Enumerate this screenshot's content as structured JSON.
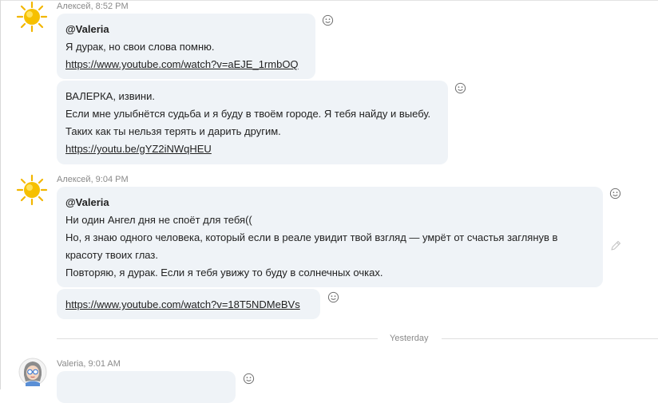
{
  "messages": [
    {
      "meta": "Алексей, 8:52 PM",
      "bubbles": [
        {
          "lines": [
            "@Valeria",
            "Я дурак, но свои слова помню.",
            "https://www.youtube.com/watch?v=aEJE_1rmbOQ"
          ]
        },
        {
          "lines": [
            "ВАЛЕРКА, извини.",
            "Если мне улыбнётся судьба и я буду в твоём городе. Я тебя найду и выебу.",
            "Таких как ты нельзя терять и дарить другим.",
            "https://youtu.be/gYZ2iNWqHEU"
          ]
        }
      ]
    },
    {
      "meta": "Алексей, 9:04 PM",
      "bubbles": [
        {
          "lines": [
            "@Valeria",
            "Ни один Ангел дня не споёт для тебя((",
            "Но, я знаю одного человека, который если в реале увидит твой взгляд — умрёт от счастья заглянув в",
            "красоту твоих глаз.",
            "Повторяю, я дурак. Если я тебя увижу то буду в солнечных очках."
          ]
        },
        {
          "lines": [
            "https://www.youtube.com/watch?v=18T5NDMeBVs"
          ]
        }
      ]
    }
  ],
  "divider": {
    "label": "Yesterday"
  },
  "last_message": {
    "meta": "Valeria, 9:01 AM"
  },
  "icons": {
    "reaction": "smiley-reaction-icon",
    "edit": "pencil-edit-icon",
    "sender_avatar": "sun-avatar",
    "recipient_avatar": "girl-with-glasses-avatar"
  },
  "colors": {
    "bubble": "#eff3f7",
    "sun": "#f6c000",
    "meta_text": "#8a8a8a"
  }
}
